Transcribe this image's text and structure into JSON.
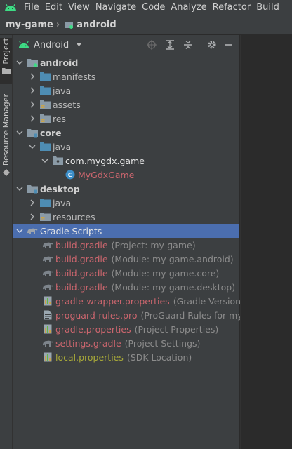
{
  "menu": [
    "File",
    "Edit",
    "View",
    "Navigate",
    "Code",
    "Analyze",
    "Refactor",
    "Build"
  ],
  "breadcrumb": {
    "project": "my-game",
    "module": "android"
  },
  "side_tabs": {
    "project": "Project",
    "resource_manager": "Resource Manager"
  },
  "panel": {
    "view_mode": "Android"
  },
  "colors": {
    "selection": "#4b6eaf",
    "folder": "#4e8db3",
    "file_red": "#cc666e",
    "file_olive": "#a7a839",
    "android_green": "#3ddc84"
  },
  "tree": [
    {
      "label": "android",
      "bold": true,
      "expanded": true
    },
    {
      "label": "manifests"
    },
    {
      "label": "java"
    },
    {
      "label": "assets"
    },
    {
      "label": "res"
    },
    {
      "label": "core",
      "bold": true,
      "expanded": true
    },
    {
      "label": "java",
      "expanded": true
    },
    {
      "label": "com.mygdx.game",
      "expanded": true
    },
    {
      "label": "MyGdxGame"
    },
    {
      "label": "desktop",
      "bold": true,
      "expanded": true
    },
    {
      "label": "java"
    },
    {
      "label": "resources"
    },
    {
      "label": "Gradle Scripts",
      "expanded": true,
      "selected": true
    },
    {
      "label": "build.gradle",
      "hint": "(Project: my-game)"
    },
    {
      "label": "build.gradle",
      "hint": "(Module: my-game.android)"
    },
    {
      "label": "build.gradle",
      "hint": "(Module: my-game.core)"
    },
    {
      "label": "build.gradle",
      "hint": "(Module: my-game.desktop)"
    },
    {
      "label": "gradle-wrapper.properties",
      "hint": "(Gradle Version)"
    },
    {
      "label": "proguard-rules.pro",
      "hint": "(ProGuard Rules for my-g"
    },
    {
      "label": "gradle.properties",
      "hint": "(Project Properties)"
    },
    {
      "label": "settings.gradle",
      "hint": "(Project Settings)"
    },
    {
      "label": "local.properties",
      "hint": "(SDK Location)"
    }
  ]
}
